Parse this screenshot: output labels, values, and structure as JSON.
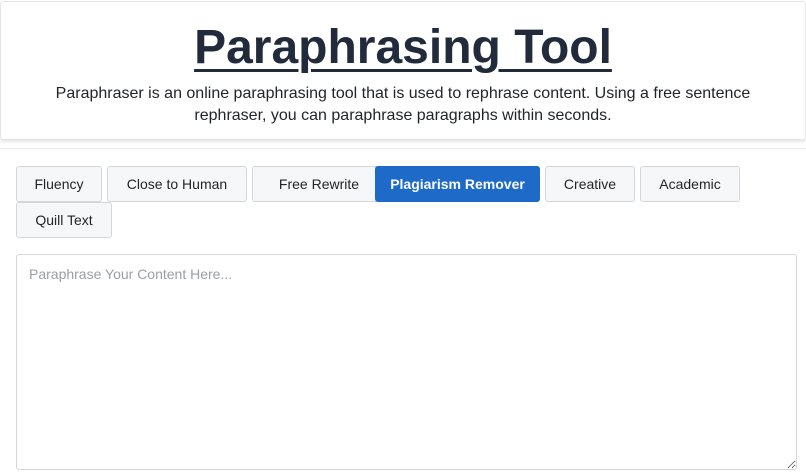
{
  "header": {
    "title": "Paraphrasing Tool",
    "description": "Paraphraser is an online paraphrasing tool that is used to rephrase content. Using a free sentence rephraser, you can paraphrase paragraphs within seconds."
  },
  "modes": {
    "items": [
      {
        "label": "Fluency",
        "active": false
      },
      {
        "label": "Close to Human",
        "active": false
      },
      {
        "label": "Free Rewrite",
        "active": false
      },
      {
        "label": "Plagiarism Remover",
        "active": true
      },
      {
        "label": "Creative",
        "active": false
      },
      {
        "label": "Academic",
        "active": false
      },
      {
        "label": "Quill Text",
        "active": false
      }
    ]
  },
  "editor": {
    "placeholder": "Paraphrase Your Content Here...",
    "value": ""
  },
  "colors": {
    "accent": "#1d6ac9",
    "title": "#212b3c",
    "tab_background": "#f6f7f9"
  }
}
